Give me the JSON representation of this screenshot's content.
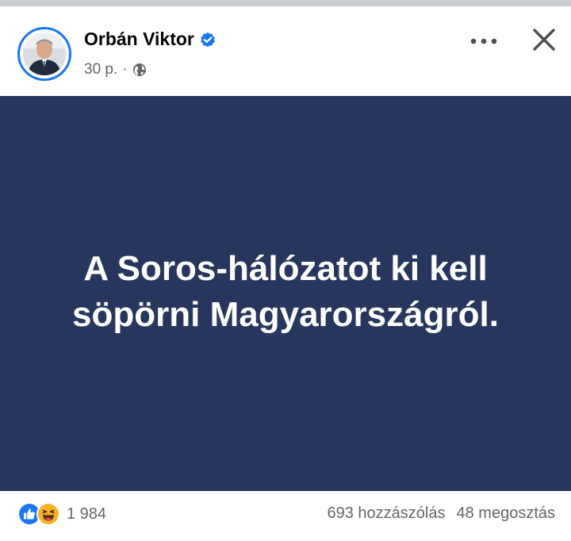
{
  "post": {
    "author": "Orbán Viktor",
    "time": "30 p.",
    "separator": "·",
    "audience_icon": "globe-icon",
    "verified_icon": "verified-badge-icon",
    "image_text": "A Soros-hálózatot ki kell söpörni Magyarországról.",
    "colors": {
      "image_bg": "#26365c",
      "accent": "#1877f2"
    }
  },
  "footer": {
    "reaction_icons": [
      "like-icon",
      "haha-icon"
    ],
    "reaction_count": "1 984",
    "comments": "693 hozzászólás",
    "shares": "48 megosztás"
  }
}
